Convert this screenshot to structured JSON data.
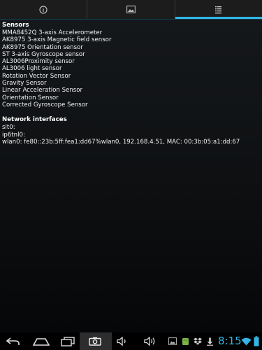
{
  "tabs": [
    {
      "icon": "info-icon",
      "active": false
    },
    {
      "icon": "image-icon",
      "active": false
    },
    {
      "icon": "list-icon",
      "active": true
    }
  ],
  "sensors": {
    "title": "Sensors",
    "items": [
      "MMA8452Q 3-axis Accelerometer",
      "AK8975 3-axis Magnetic field sensor",
      "AK8975 Orientation sensor",
      "ST 3-axis Gyroscope sensor",
      "AL3006Proximity sensor",
      "AL3006 light sensor",
      "Rotation Vector Sensor",
      "Gravity Sensor",
      "Linear Acceleration Sensor",
      "Orientation Sensor",
      "Corrected Gyroscope Sensor"
    ]
  },
  "network": {
    "title": "Network interfaces",
    "items": [
      "sit0:",
      "ip6tnl0:",
      "wlan0: fe80::23b:5ff:fea1:dd67%wlan0, 192.168.4.51, MAC: 00:3b:05:a1:dd:67"
    ]
  },
  "status": {
    "time": "8:15",
    "accent_color": "#33b5e5"
  }
}
